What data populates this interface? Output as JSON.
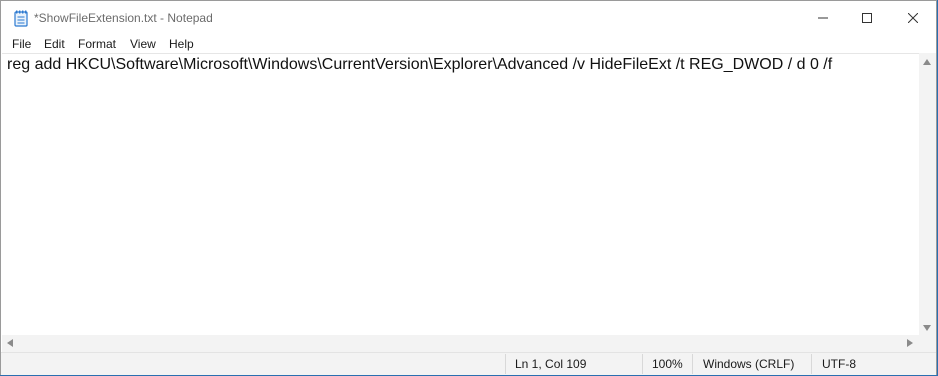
{
  "window": {
    "title": "*ShowFileExtension.txt - Notepad",
    "icon": "notepad-icon"
  },
  "menu": {
    "items": [
      "File",
      "Edit",
      "Format",
      "View",
      "Help"
    ]
  },
  "editor": {
    "content": "reg add HKCU\\Software\\Microsoft\\Windows\\CurrentVersion\\Explorer\\Advanced /v HideFileExt /t REG_DWOD / d 0 /f"
  },
  "status": {
    "position": "Ln 1, Col 109",
    "zoom": "100%",
    "line_ending": "Windows (CRLF)",
    "encoding": "UTF-8"
  },
  "colors": {
    "accent": "#2b79d0",
    "desktop": "#2a6fb0"
  }
}
